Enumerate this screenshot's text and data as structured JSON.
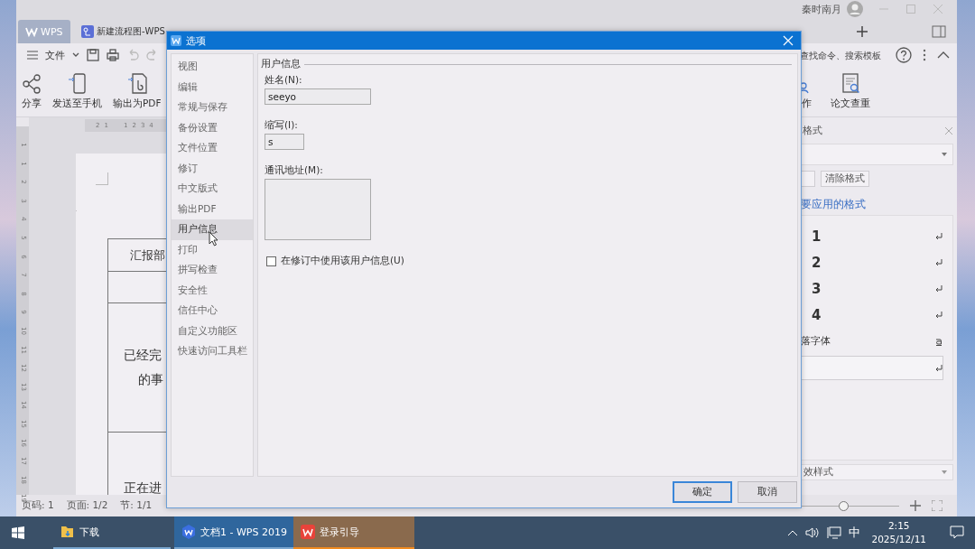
{
  "window": {
    "user": "秦时南月",
    "tabs": [
      {
        "label": "WPS",
        "kind": "home",
        "selected": true
      },
      {
        "label": "新建流程图-WPS",
        "kind": "flow",
        "selected": false
      }
    ]
  },
  "toolbar": {
    "menu": "文件",
    "search": {
      "placeholder": "查找命令、搜索模板"
    }
  },
  "ribbon": [
    {
      "label": "分享",
      "kind": "share"
    },
    {
      "label": "发送至手机",
      "kind": "phone"
    },
    {
      "label": "输出为PDF",
      "kind": "pdf"
    },
    {
      "label": "作",
      "kind": "collab"
    },
    {
      "label": "论文查重",
      "kind": "check"
    }
  ],
  "ruler": {
    "horizontal": [
      "2",
      "1",
      "1",
      "2",
      "3",
      "4"
    ],
    "vertical": [
      "1",
      "1",
      "2",
      "3",
      "4",
      "5",
      "6",
      "7",
      "8",
      "9",
      "10",
      "11",
      "12",
      "13",
      "14",
      "15",
      "16",
      "17",
      "18",
      "19"
    ]
  },
  "document": {
    "rows": [
      {
        "lines": [
          "汇报部"
        ]
      },
      {
        "lines": []
      },
      {
        "lines": [
          "已经完",
          "的事"
        ]
      },
      {
        "lines": [
          "正在进"
        ]
      }
    ]
  },
  "styles_pane": {
    "title": "格式",
    "clear_button": "清除格式",
    "prompt": "要应用的格式",
    "styles": [
      {
        "label": "1",
        "kind": "heading",
        "selected": false
      },
      {
        "label": "2",
        "kind": "heading",
        "selected": false
      },
      {
        "label": "3",
        "kind": "heading",
        "selected": false
      },
      {
        "label": "4",
        "kind": "heading",
        "selected": false
      },
      {
        "label": "落字体",
        "kind": "character",
        "selected": false
      },
      {
        "kind": "paragraph",
        "selected": true
      }
    ],
    "filter": "效样式"
  },
  "status_bar": {
    "items": [
      "页码: 1",
      "页面: 1/2",
      "节: 1/1"
    ],
    "zoom": {
      "level": 0.52
    }
  },
  "dialog": {
    "title": "选项",
    "categories": [
      {
        "label": "视图",
        "selected": false
      },
      {
        "label": "编辑",
        "selected": false
      },
      {
        "label": "常规与保存",
        "selected": false
      },
      {
        "label": "备份设置",
        "selected": false
      },
      {
        "label": "文件位置",
        "selected": false
      },
      {
        "label": "修订",
        "selected": false
      },
      {
        "label": "中文版式",
        "selected": false
      },
      {
        "label": "输出PDF",
        "selected": false
      },
      {
        "label": "用户信息",
        "selected": true
      },
      {
        "label": "打印",
        "selected": false
      },
      {
        "label": "拼写检查",
        "selected": false
      },
      {
        "label": "安全性",
        "selected": false
      },
      {
        "label": "信任中心",
        "selected": false
      },
      {
        "label": "自定义功能区",
        "selected": false
      },
      {
        "label": "快速访问工具栏",
        "selected": false
      }
    ],
    "section": "用户信息",
    "fields": [
      {
        "label": "姓名(N):",
        "value": "seeyo",
        "kind": "text"
      },
      {
        "label": "缩写(I):",
        "value": "s",
        "kind": "short"
      },
      {
        "label": "通讯地址(M):",
        "kind": "area"
      }
    ],
    "checkbox": {
      "label": "在修订中使用该用户信息(U)",
      "checked": false
    },
    "buttons": [
      {
        "label": "确定",
        "default": true
      },
      {
        "label": "取消",
        "default": false
      }
    ]
  },
  "taskbar": {
    "apps": [
      {
        "label": "下载",
        "kind": "folder",
        "active": false,
        "attention": false
      },
      {
        "label": "文档1 - WPS 2019",
        "kind": "wps",
        "active": true,
        "attention": false
      },
      {
        "label": "登录引导",
        "kind": "login",
        "active": false,
        "attention": true
      }
    ],
    "ime": "中",
    "time": "2:15",
    "date": "2025/12/11"
  }
}
